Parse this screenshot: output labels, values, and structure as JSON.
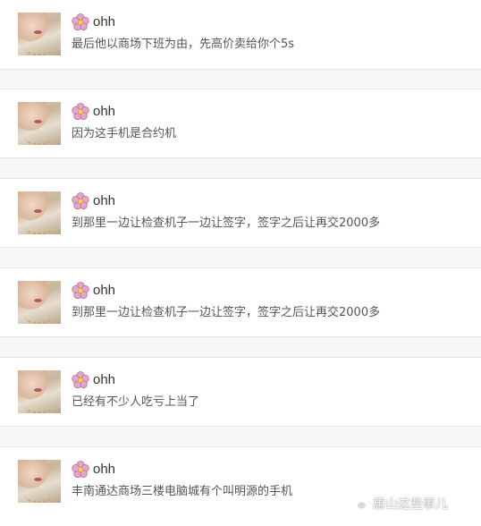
{
  "colors": {
    "background": "#ffffff",
    "separator": "#e6e6e6",
    "gap": "#f7f7f7",
    "username": "#333333",
    "message": "#555555",
    "flower_petal": "#e4a7c9"
  },
  "comments": [
    {
      "username": "ohh",
      "badge_icon": "flower-icon",
      "text": "最后他以商场下班为由，先高价卖给你个5s"
    },
    {
      "username": "ohh",
      "badge_icon": "flower-icon",
      "text": "因为这手机是合约机"
    },
    {
      "username": "ohh",
      "badge_icon": "flower-icon",
      "text": "到那里一边让检查机子一边让签字，签字之后让再交2000多"
    },
    {
      "username": "ohh",
      "badge_icon": "flower-icon",
      "text": "到那里一边让检查机子一边让签字，签字之后让再交2000多"
    },
    {
      "username": "ohh",
      "badge_icon": "flower-icon",
      "text": "已经有不少人吃亏上当了"
    },
    {
      "username": "ohh",
      "badge_icon": "flower-icon",
      "text": "丰南通达商场三楼电脑城有个叫明源的手机"
    }
  ],
  "watermark": {
    "icon": "wechat-icon",
    "text": "唐山这些事儿"
  }
}
